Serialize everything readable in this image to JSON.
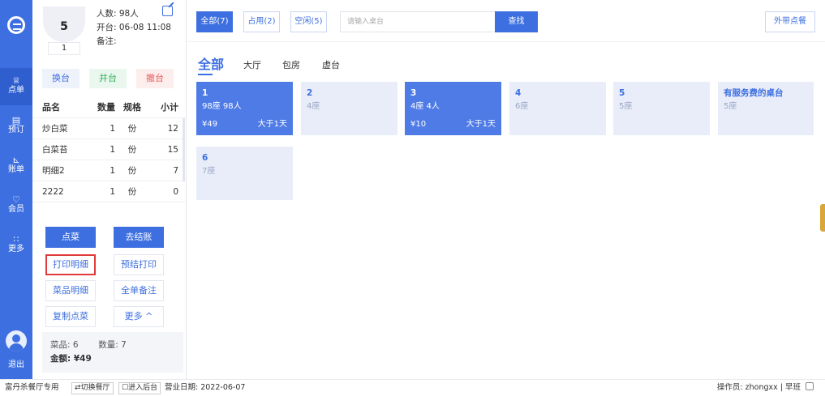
{
  "nav": {
    "logo_icon": "app-logo-icon",
    "items": [
      {
        "label": "点单",
        "icon": "menu-icon"
      },
      {
        "label": "预订",
        "icon": "reserve-icon"
      },
      {
        "label": "账单",
        "icon": "bill-icon"
      },
      {
        "label": "会员",
        "icon": "member-icon"
      },
      {
        "label": "更多",
        "icon": "more-icon"
      }
    ],
    "logout_label": "退出"
  },
  "order": {
    "table_number": "5",
    "table_sub": "1",
    "people": "人数: 98人",
    "opened": "开台: 06-08 11:08",
    "remark": "备注:",
    "buttons": {
      "change": "换台",
      "merge": "并台",
      "cancel": "撤台"
    },
    "columns": [
      "品名",
      "数量",
      "规格",
      "小计"
    ],
    "items": [
      {
        "name": "炒白菜",
        "qty": "1",
        "unit": "份",
        "subtotal": "12"
      },
      {
        "name": "白菜苔",
        "qty": "1",
        "unit": "份",
        "subtotal": "15"
      },
      {
        "name": "明细2",
        "qty": "1",
        "unit": "份",
        "subtotal": "7"
      },
      {
        "name": "2222",
        "qty": "1",
        "unit": "份",
        "subtotal": "0"
      }
    ],
    "actions": {
      "order_dish": "点菜",
      "checkout": "去结账",
      "print_detail": "打印明细",
      "pre_print": "预结打印",
      "dish_detail": "菜品明细",
      "order_remark": "全单备注",
      "copy_dish": "复制点菜",
      "more": "更多 ^"
    },
    "summary": {
      "dishes": "菜品: 6",
      "quantity": "数量: 7",
      "amount": "金额: ¥49"
    }
  },
  "main": {
    "filter_tabs": [
      "全部(7)",
      "占用(2)",
      "空闲(5)"
    ],
    "search_placeholder": "请输入桌台",
    "search_button": "查找",
    "takeout_button": "外带点餐",
    "area_tabs": [
      "全部",
      "大厅",
      "包房",
      "虚台"
    ],
    "tables": [
      {
        "name": "1",
        "seats": "98座 98人",
        "price": "¥49",
        "duration": "大于1天",
        "busy": true
      },
      {
        "name": "2",
        "seats": "4座",
        "busy": false
      },
      {
        "name": "3",
        "seats": "4座 4人",
        "price": "¥10",
        "duration": "大于1天",
        "busy": true
      },
      {
        "name": "4",
        "seats": "6座",
        "busy": false
      },
      {
        "name": "5",
        "seats": "5座",
        "busy": false
      },
      {
        "name": "有服务费的桌台",
        "seats": "5座",
        "busy": false
      },
      {
        "name": "6",
        "seats": "7座",
        "busy": false
      }
    ]
  },
  "status_bar": {
    "store": "富丹杀餐厅专用",
    "switch_btn": "⇄切换餐厅",
    "backend_btn": "☐进入后台",
    "business_date": "营业日期: 2022-06-07",
    "operator": "操作员: zhongxx | 早班"
  },
  "colors": {
    "accent": "#3d6fe0",
    "busy_card": "#4f7be6",
    "idle_card": "#e8edf9",
    "highlight_border": "#e03a3a"
  }
}
